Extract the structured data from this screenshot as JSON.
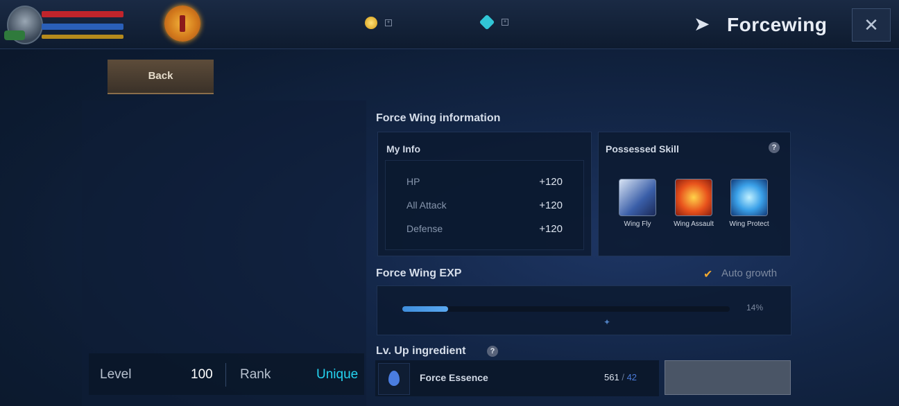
{
  "header": {
    "title": "Forcewing",
    "hp_text": "",
    "mp_text": "",
    "currencies": [
      {
        "icon": "gold-coin-icon",
        "value": ""
      },
      {
        "icon": "gem-icon",
        "value": ""
      }
    ]
  },
  "back_label": "Back",
  "summary": {
    "level_label": "Level",
    "level_value": "100",
    "rank_label": "Rank",
    "rank_value": "Unique"
  },
  "info": {
    "title": "Force Wing information",
    "my_info": {
      "title": "My Info",
      "stats": [
        {
          "name": "HP",
          "value": "+120"
        },
        {
          "name": "All Attack",
          "value": "+120"
        },
        {
          "name": "Defense",
          "value": "+120"
        }
      ]
    },
    "skills": {
      "title": "Possessed Skill",
      "items": [
        {
          "name": "Wing Fly"
        },
        {
          "name": "Wing Assault"
        },
        {
          "name": "Wing Protect"
        }
      ]
    }
  },
  "exp": {
    "title": "Force Wing EXP",
    "auto_growth_label": "Auto growth",
    "progress": 0.14,
    "progress_text": "14%"
  },
  "ingredient": {
    "title": "Lv. Up ingredient",
    "name": "Force Essence",
    "owned": "561",
    "separator": "/",
    "required": "42"
  },
  "colors": {
    "rank": "#24d3f0",
    "accent_gold": "#f0a830"
  }
}
